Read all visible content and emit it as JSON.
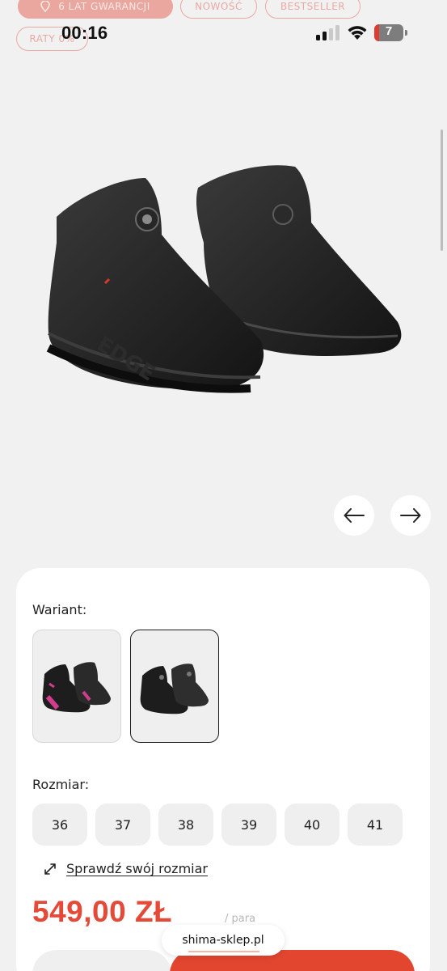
{
  "status_bar": {
    "time": "00:16",
    "battery": "7"
  },
  "badges": {
    "warranty": "6 LAT GWARANCJI",
    "new": "NOWOŚĆ",
    "bestseller": "BESTSELLER",
    "installments": "RATY 0%"
  },
  "gallery": {
    "prev_icon": "arrow-left-icon",
    "next_icon": "arrow-right-icon"
  },
  "variant": {
    "label": "Wariant:",
    "options": [
      "black-pink",
      "black"
    ],
    "selected_index": 1
  },
  "size": {
    "label": "Rozmiar:",
    "options": [
      "36",
      "37",
      "38",
      "39",
      "40",
      "41"
    ],
    "guide_link": "Sprawdź swój rozmiar"
  },
  "price": {
    "value": "549,00 ZŁ",
    "unit": "/ para"
  },
  "browser": {
    "url": "shima-sklep.pl"
  },
  "colors": {
    "accent": "#e44a37",
    "badge": "#eaa79f",
    "card_bg": "#ffffff",
    "page_bg": "#f2f1f1"
  }
}
